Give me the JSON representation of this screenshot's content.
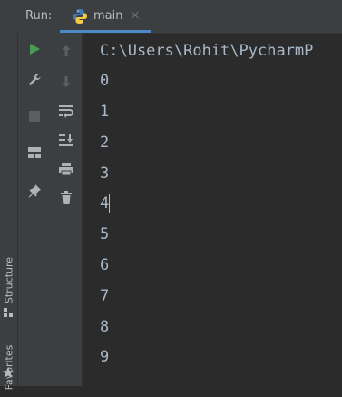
{
  "run_panel": {
    "label": "Run:",
    "tab": {
      "name": "main",
      "close": "×",
      "icon": "python-icon"
    }
  },
  "left_stripe": {
    "structure": "Structure",
    "favorites": "Favorites"
  },
  "toolbar": {
    "buttons": [
      "run-icon",
      "wrench-icon",
      "stop-icon",
      "layout-icon",
      "pin-icon"
    ],
    "secondary": [
      "up-arrow-icon",
      "down-arrow-icon",
      "soft-wrap-icon",
      "scroll-to-end-icon",
      "print-icon",
      "trash-icon"
    ]
  },
  "console": {
    "path": "C:\\Users\\Rohit\\PycharmP",
    "lines": [
      "0",
      "1",
      "2",
      "3",
      "4",
      "5",
      "6",
      "7",
      "8",
      "9"
    ]
  },
  "colors": {
    "background": "#2b2b2b",
    "panel": "#3c3f41",
    "accent": "#4a88c7",
    "run_green": "#499c54"
  }
}
